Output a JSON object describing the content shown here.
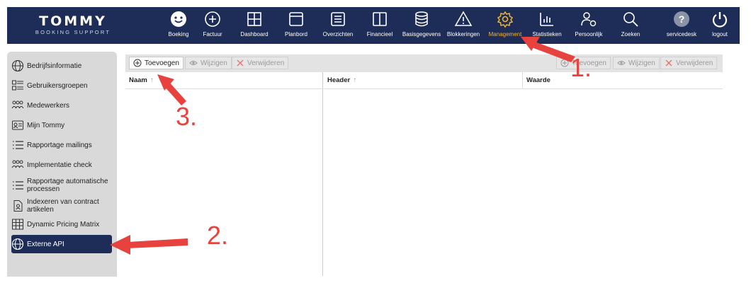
{
  "app": {
    "logo_main": "TOMMY",
    "logo_sub": "BOOKING SUPPORT"
  },
  "nav": [
    {
      "label": "Boeking",
      "icon": "smiley-icon"
    },
    {
      "label": "Factuur",
      "icon": "plus-circle-icon"
    },
    {
      "label": "Dashboard",
      "icon": "grid-icon"
    },
    {
      "label": "Planbord",
      "icon": "window-icon"
    },
    {
      "label": "Overzichten",
      "icon": "list-icon"
    },
    {
      "label": "Financieel",
      "icon": "book-icon"
    },
    {
      "label": "Basisgegevens",
      "icon": "database-icon"
    },
    {
      "label": "Blokkeringen",
      "icon": "warning-icon"
    },
    {
      "label": "Management",
      "icon": "gear-icon",
      "active": true
    },
    {
      "label": "Statistieken",
      "icon": "bar-chart-icon"
    },
    {
      "label": "Persoonlijk",
      "icon": "user-gear-icon"
    },
    {
      "label": "Zoeken",
      "icon": "search-icon"
    },
    {
      "label": "servicedesk",
      "icon": "help-icon"
    },
    {
      "label": "logout",
      "icon": "power-icon"
    }
  ],
  "sidebar": {
    "items": [
      {
        "label": "Bedrijfsinformatie",
        "icon": "globe-icon"
      },
      {
        "label": "Gebruikersgroepen",
        "icon": "groups-icon"
      },
      {
        "label": "Medewerkers",
        "icon": "people-icon"
      },
      {
        "label": "Mijn Tommy",
        "icon": "id-card-icon"
      },
      {
        "label": "Rapportage mailings",
        "icon": "list-icon"
      },
      {
        "label": "Implementatie check",
        "icon": "people-icon"
      },
      {
        "label": "Rapportage automatische processen",
        "icon": "list-icon"
      },
      {
        "label": "Indexeren van contract artikelen",
        "icon": "document-user-icon"
      },
      {
        "label": "Dynamic Pricing Matrix",
        "icon": "table-icon"
      },
      {
        "label": "Externe API",
        "icon": "globe-icon",
        "active": true
      }
    ]
  },
  "toolbar": {
    "left": {
      "add": "Toevoegen",
      "edit": "Wijzigen",
      "delete": "Verwijderen"
    },
    "right": {
      "add": "Toevoegen",
      "edit": "Wijzigen",
      "delete": "Verwijderen"
    }
  },
  "table_left": {
    "columns": [
      "Naam"
    ]
  },
  "table_right": {
    "columns": [
      "Header",
      "Waarde"
    ]
  },
  "annotations": [
    "1.",
    "2.",
    "3."
  ],
  "colors": {
    "nav_bg": "#1e2d57",
    "active": "#f2b32b",
    "annotation": "#e8423f"
  }
}
